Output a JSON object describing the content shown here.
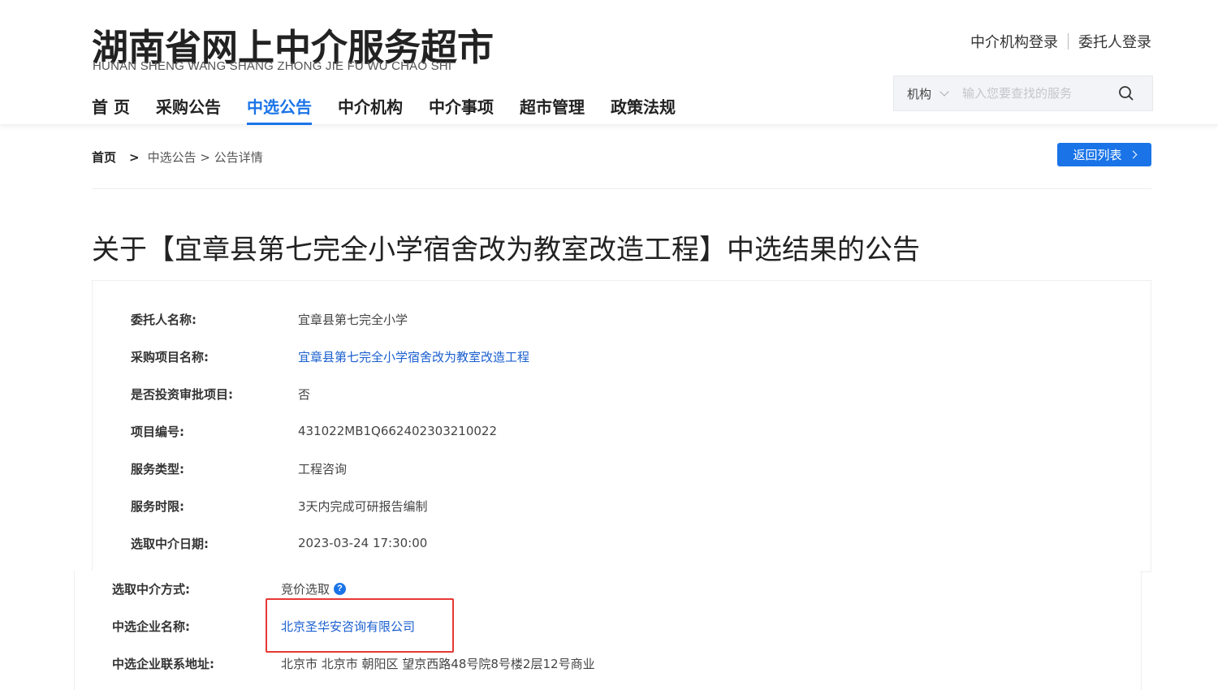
{
  "header": {
    "logo_cn": "湖南省网上中介服务超市",
    "logo_en": "HUNAN SHENG WANG SHANG ZHONG JIE FU WU CHAO SHI",
    "login_agency": "中介机构登录",
    "login_client": "委托人登录"
  },
  "nav": {
    "items": [
      {
        "label": "首 页"
      },
      {
        "label": "采购公告"
      },
      {
        "label": "中选公告"
      },
      {
        "label": "中介机构"
      },
      {
        "label": "中介事项"
      },
      {
        "label": "超市管理"
      },
      {
        "label": "政策法规"
      }
    ],
    "active_index": 2
  },
  "search": {
    "category": "机构",
    "placeholder": "输入您要查找的服务"
  },
  "breadcrumb": {
    "home": "首页",
    "arrow": ">",
    "path": "中选公告 > 公告详情"
  },
  "back_button": "返回列表",
  "title": "关于【宜章县第七完全小学宿舍改为教室改造工程】中选结果的公告",
  "details": [
    {
      "label": "委托人名称:",
      "value": "宜章县第七完全小学"
    },
    {
      "label": "采购项目名称:",
      "value": "宜章县第七完全小学宿舍改为教室改造工程",
      "link": true
    },
    {
      "label": "是否投资审批项目:",
      "value": "否"
    },
    {
      "label": "项目编号:",
      "value": "431022MB1Q662402303210022"
    },
    {
      "label": "服务类型:",
      "value": "工程咨询"
    },
    {
      "label": "服务时限:",
      "value": "3天内完成可研报告编制"
    },
    {
      "label": "选取中介日期:",
      "value": "2023-03-24 17:30:00"
    }
  ],
  "details_zoomed": [
    {
      "label": "选取中介方式:",
      "value": "竞价选取",
      "help": "?"
    },
    {
      "label": "中选企业名称:",
      "value": "北京圣华安咨询有限公司",
      "link": true
    },
    {
      "label": "中选企业联系地址:",
      "value": "北京市 北京市 朝阳区 望京西路48号院8号楼2层12号商业"
    }
  ],
  "colors": {
    "accent": "#1a74e8",
    "link": "#1a5fcf",
    "highlight": "#e53935"
  }
}
